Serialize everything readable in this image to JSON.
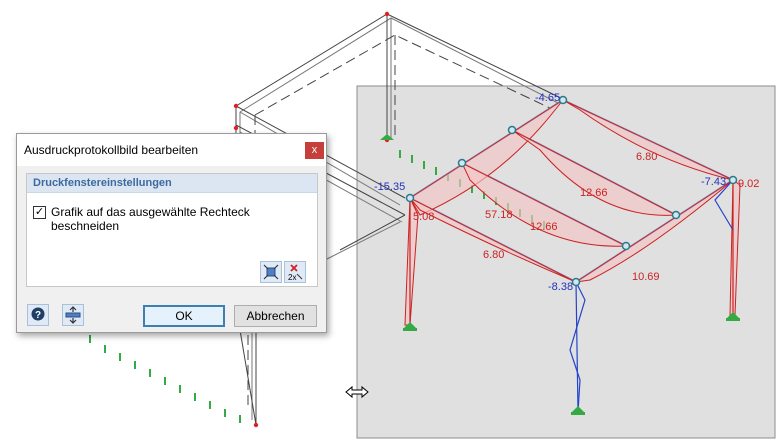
{
  "dialog": {
    "title": "Ausdruckprotokollbild bearbeiten",
    "close_glyph": "x",
    "group_title": "Druckfenstereinstellungen",
    "checkbox_label": "Grafik auf das ausgewählte Rechteck beschneiden",
    "checkbox_checked": true,
    "checkbox_glyph": "✓",
    "ok_label": "OK",
    "cancel_label": "Abbrechen",
    "icons": [
      "zoom-fit-icon",
      "delete-2x-icon",
      "help-icon",
      "fit-height-icon"
    ]
  },
  "model": {
    "values": [
      "-4.65",
      "-15.35",
      "5.08",
      "57.18",
      "12.66",
      "6.80",
      "12.66",
      "6.80",
      "-7.43",
      "9.02",
      "-8.38",
      "10.69"
    ]
  },
  "colors": {
    "selection_bg": "#e0e0e0",
    "moment_red": "#cc2222",
    "axial_blue": "#2244cc",
    "support_green": "#33aa44",
    "beam_blue": "#6aa0d8"
  }
}
